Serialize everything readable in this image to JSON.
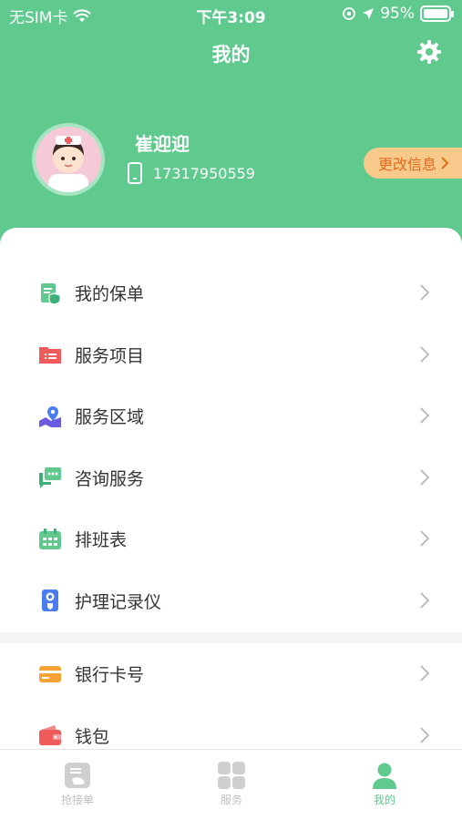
{
  "status_bar": {
    "carrier": "无SIM卡",
    "time": "下午3:09",
    "battery_percent": "95%"
  },
  "nav": {
    "title": "我的",
    "settings_icon": "gear-icon"
  },
  "profile": {
    "name": "崔迎迎",
    "phone": "17317950559",
    "edit_label": "更改信息",
    "avatar_icon": "nurse-avatar"
  },
  "menu": {
    "group1": [
      {
        "label": "我的保单",
        "icon": "policy-icon",
        "color": "#5fc98e"
      },
      {
        "label": "服务项目",
        "icon": "folder-icon",
        "color": "#ef5a5a"
      },
      {
        "label": "服务区域",
        "icon": "map-pin-icon",
        "color": "#6a5ae0"
      },
      {
        "label": "咨询服务",
        "icon": "chat-icon",
        "color": "#5fc98e"
      },
      {
        "label": "排班表",
        "icon": "calendar-icon",
        "color": "#5fc98e"
      },
      {
        "label": "护理记录仪",
        "icon": "recorder-icon",
        "color": "#4a7cf0"
      }
    ],
    "group2": [
      {
        "label": "银行卡号",
        "icon": "bank-card-icon",
        "color": "#f7a234"
      },
      {
        "label": "钱包",
        "icon": "wallet-icon",
        "color": "#ef5a5a"
      }
    ]
  },
  "tabs": [
    {
      "label": "抢接单",
      "icon": "grab-order-icon",
      "active": false
    },
    {
      "label": "服务",
      "icon": "grid-icon",
      "active": false
    },
    {
      "label": "我的",
      "icon": "person-icon",
      "active": true
    }
  ],
  "colors": {
    "primary": "#5fc98e",
    "edit_bg": "#f7c98a",
    "edit_text": "#e26a1c"
  }
}
